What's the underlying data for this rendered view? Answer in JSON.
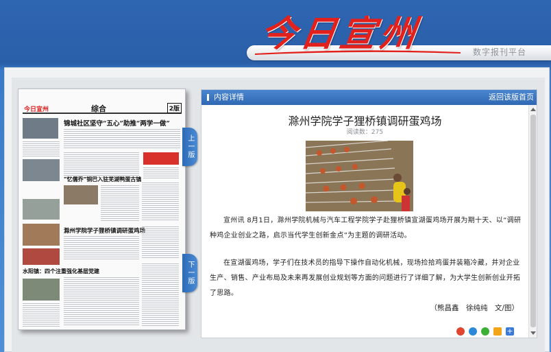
{
  "header": {
    "logo_text": "今日宣州",
    "platform_label": "数字报刊平台",
    "colors": {
      "logo_red": "#e3211c",
      "bg_blue": "#2f66b2"
    }
  },
  "newspaper": {
    "masthead": "今日宣州",
    "section": "综合",
    "page_no": "2版",
    "headlines": {
      "h1": "锦城社区坚守“五心”助推“两学一做”",
      "h2": "“忆儒乔”铜巴入驻芜湖鸭蛋古镇",
      "h3": "滁州学院学子狸桥镇调研蛋鸡场",
      "h4": "水阳镇：四个注重强化基层党建"
    },
    "nav": {
      "prev_label": "上一版",
      "next_label": "下一版"
    }
  },
  "content_panel": {
    "bar_title": "内容详情",
    "back_link": "返回该版首页",
    "article": {
      "title": "滁州学院学子狸桥镇调研蛋鸡场",
      "reads": "阅读数：275",
      "para1": "宣州讯 8月1日，滁州学院机械与汽车工程学院学子赴狸桥镇宣湖蛋鸡场开展为期十天、以“调研种鸡企业创业之路，启示当代学生创新金点”为主题的调研活动。",
      "para2": "在宣湖蛋鸡场，学子们在技术员的指导下操作自动化机械，现场捡拾鸡蛋并装箱冷藏，并对企业生产、销售、产业布局及未来再发展创业规划等方面的问题进行了详细了解，为大学生创新创业开拓了思路。",
      "author": "（熊昌鑫　徐纯纯　文/图）"
    },
    "share_icons": [
      "weibo-icon",
      "qzone-icon",
      "wechat-icon",
      "star-icon",
      "plus-icon"
    ]
  }
}
